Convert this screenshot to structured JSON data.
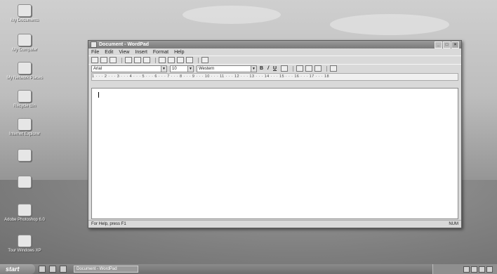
{
  "window": {
    "title": "Document - WordPad",
    "menu": [
      "File",
      "Edit",
      "View",
      "Insert",
      "Format",
      "Help"
    ],
    "font_name": "Arial",
    "font_size": "10",
    "script": "Western",
    "bold_label": "B",
    "italic_label": "/",
    "underline_label": "U",
    "ruler_text": "1 · · · 2 · · · 3 · · · 4 · · · 5 · · · 6 · · · 7 · · · 8 · · · 9 · · · 10 · · · 11 · · · 12 · · · 13 · · · 14 · · · 15 · · · 16 · · · 17 · · · 18",
    "status_text": "For Help, press F1",
    "num_indicator": "NUM"
  },
  "desktop_icons": [
    {
      "label": "My Documents"
    },
    {
      "label": "My Computer"
    },
    {
      "label": "My Network Places"
    },
    {
      "label": "Recycle Bin"
    },
    {
      "label": "Internet Explorer"
    },
    {
      "label": ""
    },
    {
      "label": ""
    },
    {
      "label": "Adobe Photoshop 6.0"
    },
    {
      "label": "Tour Windows XP"
    }
  ],
  "taskbar": {
    "start_label": "start",
    "task_label": "Document - WordPad"
  }
}
